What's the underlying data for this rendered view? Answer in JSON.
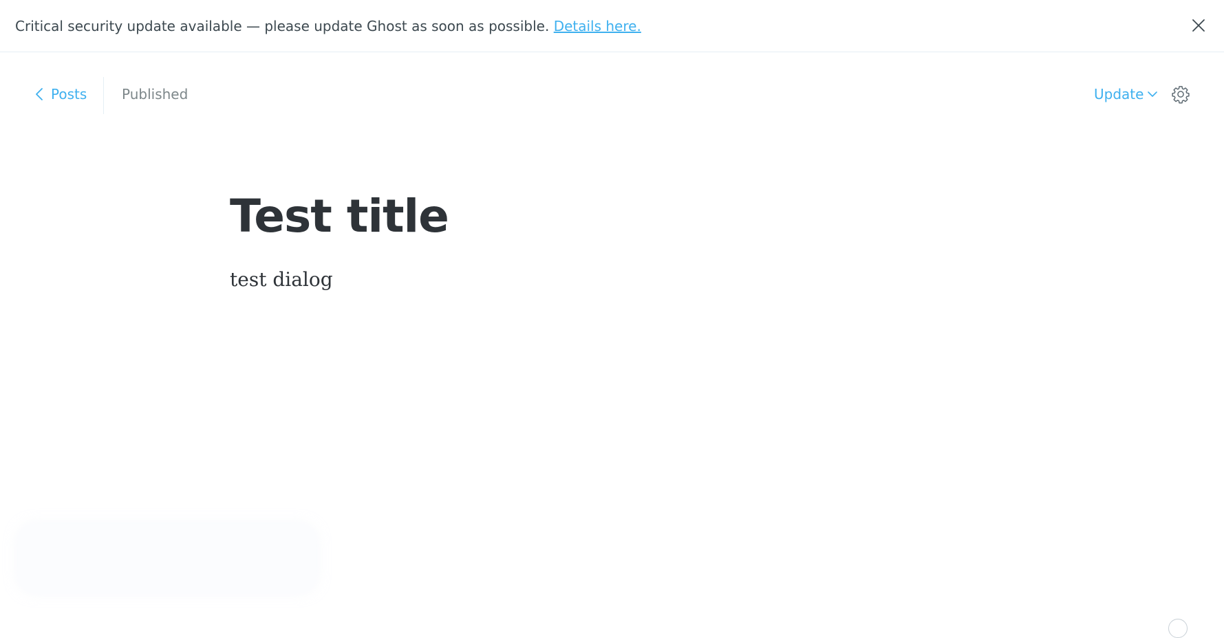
{
  "banner": {
    "message": "Critical security update available — please update Ghost as soon as possible.",
    "link_text": "Details here.",
    "close_icon": "close-icon"
  },
  "header": {
    "back_label": "Posts",
    "back_icon": "chevron-left-icon",
    "status": "Published",
    "update_label": "Update",
    "update_icon": "chevron-down-icon",
    "settings_icon": "gear-icon"
  },
  "post": {
    "title": "Test title",
    "body": "test dialog"
  },
  "colors": {
    "accent": "#3eb0ef",
    "muted": "#7d878a",
    "text": "#2e3338"
  }
}
